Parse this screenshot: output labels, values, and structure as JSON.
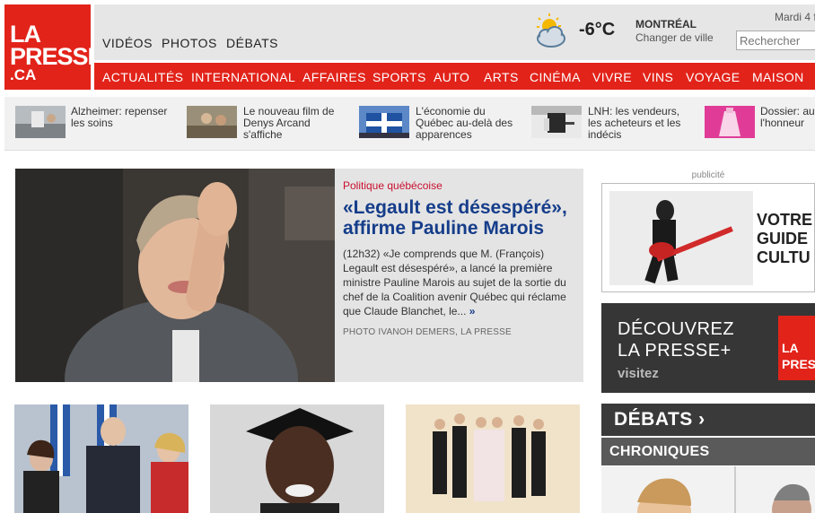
{
  "logo": {
    "line1": "LA",
    "line2": "PRESSE",
    "line3": ".CA"
  },
  "top_nav": [
    "VIDÉOS",
    "PHOTOS",
    "DÉBATS"
  ],
  "weather": {
    "temperature": "-6°C",
    "city": "MONTRÉAL",
    "change_city": "Changer de ville",
    "icon": "partly-cloudy-icon"
  },
  "date": "Mardi 4 f",
  "search": {
    "placeholder": "Rechercher"
  },
  "main_nav": [
    "ACTUALITÉS",
    "INTERNATIONAL",
    "AFFAIRES",
    "SPORTS",
    "AUTO",
    "ARTS",
    "CINÉMA",
    "VIVRE",
    "VINS",
    "VOYAGE",
    "MAISON"
  ],
  "teasers": [
    {
      "line1": "Alzheimer: repenser",
      "line2": "les soins",
      "line3": ""
    },
    {
      "line1": "Le nouveau film de",
      "line2": "Denys Arcand",
      "line3": "s'affiche"
    },
    {
      "line1": "L'économie du",
      "line2": "Québec au-delà des",
      "line3": "apparences"
    },
    {
      "line1": "LNH: les vendeurs,",
      "line2": "les acheteurs et les",
      "line3": "indécis"
    },
    {
      "line1": "Dossier: au",
      "line2": "l'honneur",
      "line3": ""
    }
  ],
  "feature": {
    "kicker": "Politique québécoise",
    "headline": "«Legault est désespéré», affirme Pauline Marois",
    "lede": "(12h32) «Je comprends que M. (François) Legault est désespéré», a lancé la première ministre Pauline Marois au sujet de la sortie du chef de la Coalition avenir Québec qui réclame que Claude Blanchet, le...",
    "more": "»",
    "credit": "PHOTO IVANOH DEMERS, LA PRESSE"
  },
  "ad": {
    "label": "publicité",
    "line1": "VOTRE",
    "line2": "GUIDE",
    "line3": "CULTU"
  },
  "promo": {
    "line1": "DÉCOUVREZ",
    "line2": "LA PRESSE+",
    "line3": "visitez",
    "logo1": "LA",
    "logo2": "PRES"
  },
  "debats": {
    "title": "DÉBATS",
    "arrow": "›"
  },
  "chroniques": {
    "title": "CHRONIQUES"
  }
}
